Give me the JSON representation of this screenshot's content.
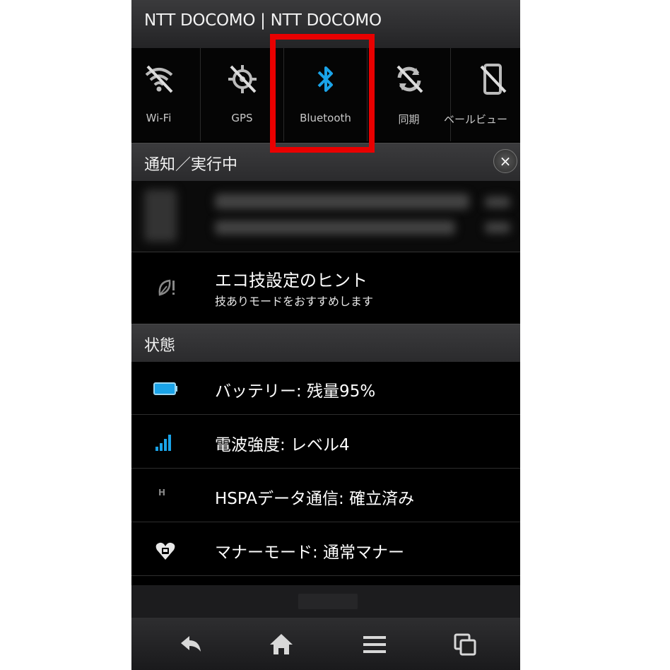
{
  "status_bar": {
    "carrier": "NTT DOCOMO | NTT DOCOMO"
  },
  "quick_settings": [
    {
      "label": "Wi-Fi",
      "icon": "wifi-off-icon",
      "state": "off"
    },
    {
      "label": "GPS",
      "icon": "gps-off-icon",
      "state": "off"
    },
    {
      "label": "Bluetooth",
      "icon": "bluetooth-icon",
      "state": "on",
      "color": "#1aa3e8"
    },
    {
      "label": "同期",
      "icon": "sync-off-icon",
      "state": "off"
    },
    {
      "label": "ベールビュー",
      "icon": "veil-view-off-icon",
      "state": "off"
    }
  ],
  "notifications": {
    "header": "通知／実行中",
    "clear_label": "×",
    "eco_tip": {
      "title": "エコ技設定のヒント",
      "subtitle": "技ありモードをおすすめします",
      "icon": "eco-leaf-icon"
    }
  },
  "status_section": {
    "header": "状態",
    "rows": [
      {
        "text": "バッテリー: 残量95%",
        "icon": "battery-icon",
        "value_percent": 95
      },
      {
        "text": "電波強度: レベル4",
        "icon": "signal-strength-icon",
        "level": 4
      },
      {
        "text": "HSPAデータ通信: 確立済み",
        "icon": "hspa-icon",
        "icon_text": "H"
      },
      {
        "text": "マナーモード: 通常マナー",
        "icon": "manner-mode-icon"
      }
    ]
  },
  "nav_bar": [
    {
      "icon": "back-icon"
    },
    {
      "icon": "home-icon"
    },
    {
      "icon": "menu-icon"
    },
    {
      "icon": "recent-apps-icon"
    }
  ],
  "colors": {
    "accent_blue": "#1aa3e8",
    "highlight_red": "#e90000",
    "background": "#000000"
  }
}
